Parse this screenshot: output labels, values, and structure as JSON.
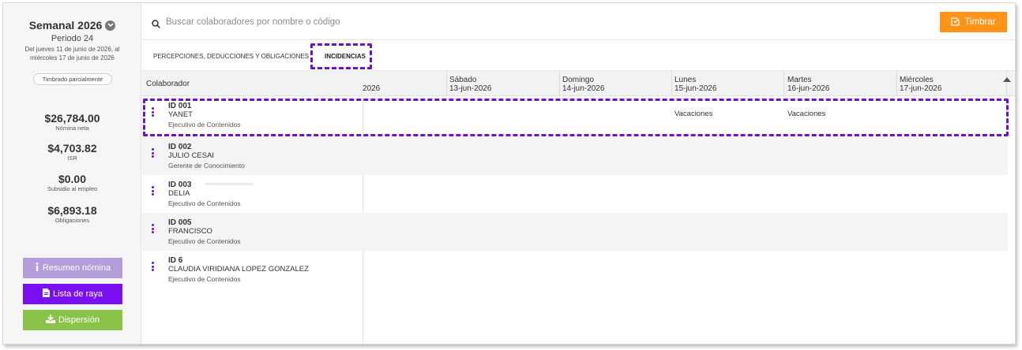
{
  "sidebar": {
    "period_title": "Semanal 2026",
    "period_number": "Periodo 24",
    "period_range": "Del jueves 11 de junio de 2026, al miércoles 17 de junio de 2026",
    "badge": "Timbrado parcialmente",
    "amounts": [
      {
        "value": "$26,784.00",
        "label": "Nómina neta"
      },
      {
        "value": "$4,703.82",
        "label": "ISR"
      },
      {
        "value": "$0.00",
        "label": "Subsidio al empleo"
      },
      {
        "value": "$6,893.18",
        "label": "Obligaciones"
      }
    ],
    "buttons": {
      "resumen": "Resumen nómina",
      "lista": "Lista de raya",
      "dispersion": "Dispersión"
    }
  },
  "search": {
    "placeholder": "Buscar colaboradores por nombre o código",
    "value": ""
  },
  "toolbar": {
    "timbrar_label": "Timbrar"
  },
  "tabs": [
    {
      "label": "PERCEPCIONES, DEDUCCIONES Y OBLIGACIONES",
      "active": false
    },
    {
      "label": "INCIDENCIAS",
      "active": true
    }
  ],
  "grid": {
    "colab_header": "Colaborador",
    "partial_header": "2026",
    "days": [
      {
        "day": "Sábado",
        "date": "13-jun-2026"
      },
      {
        "day": "Domingo",
        "date": "14-jun-2026"
      },
      {
        "day": "Lunes",
        "date": "15-jun-2026"
      },
      {
        "day": "Martes",
        "date": "16-jun-2026"
      },
      {
        "day": "Miércoles",
        "date": "17-jun-2026"
      }
    ],
    "rows": [
      {
        "id": "ID 001",
        "name": "YANET",
        "role": "Ejecutivo de Contenidos",
        "lunes": "Vacaciones",
        "martes": "Vacaciones"
      },
      {
        "id": "ID 002",
        "name": "JULIO CESAI",
        "role": "Gerente de Conocimiento"
      },
      {
        "id": "ID 003",
        "name": "DELIA",
        "role": "Ejecutivo de Contenidos"
      },
      {
        "id": "ID 005",
        "name": "FRANCISCO",
        "role": "Ejecutivo de Contenidos"
      },
      {
        "id": "ID 6",
        "name": "CLAUDIA VIRIDIANA LOPEZ GONZALEZ",
        "role": "Ejecutivo de Contenidos"
      }
    ]
  },
  "colors": {
    "accent": "#6a11d6",
    "orange": "#ff9419",
    "resumen_btn": "#b39ddb",
    "lista_btn": "#7a0ff0",
    "dispersion_btn": "#8bc34a"
  },
  "icons": {
    "search": "search-icon",
    "timbrar": "stamp-icon",
    "resumen": "info-icon",
    "lista": "file-icon",
    "dispersion": "download-icon",
    "period_toggle": "chevron-down-icon",
    "row_menu": "kebab-menu-icon"
  }
}
